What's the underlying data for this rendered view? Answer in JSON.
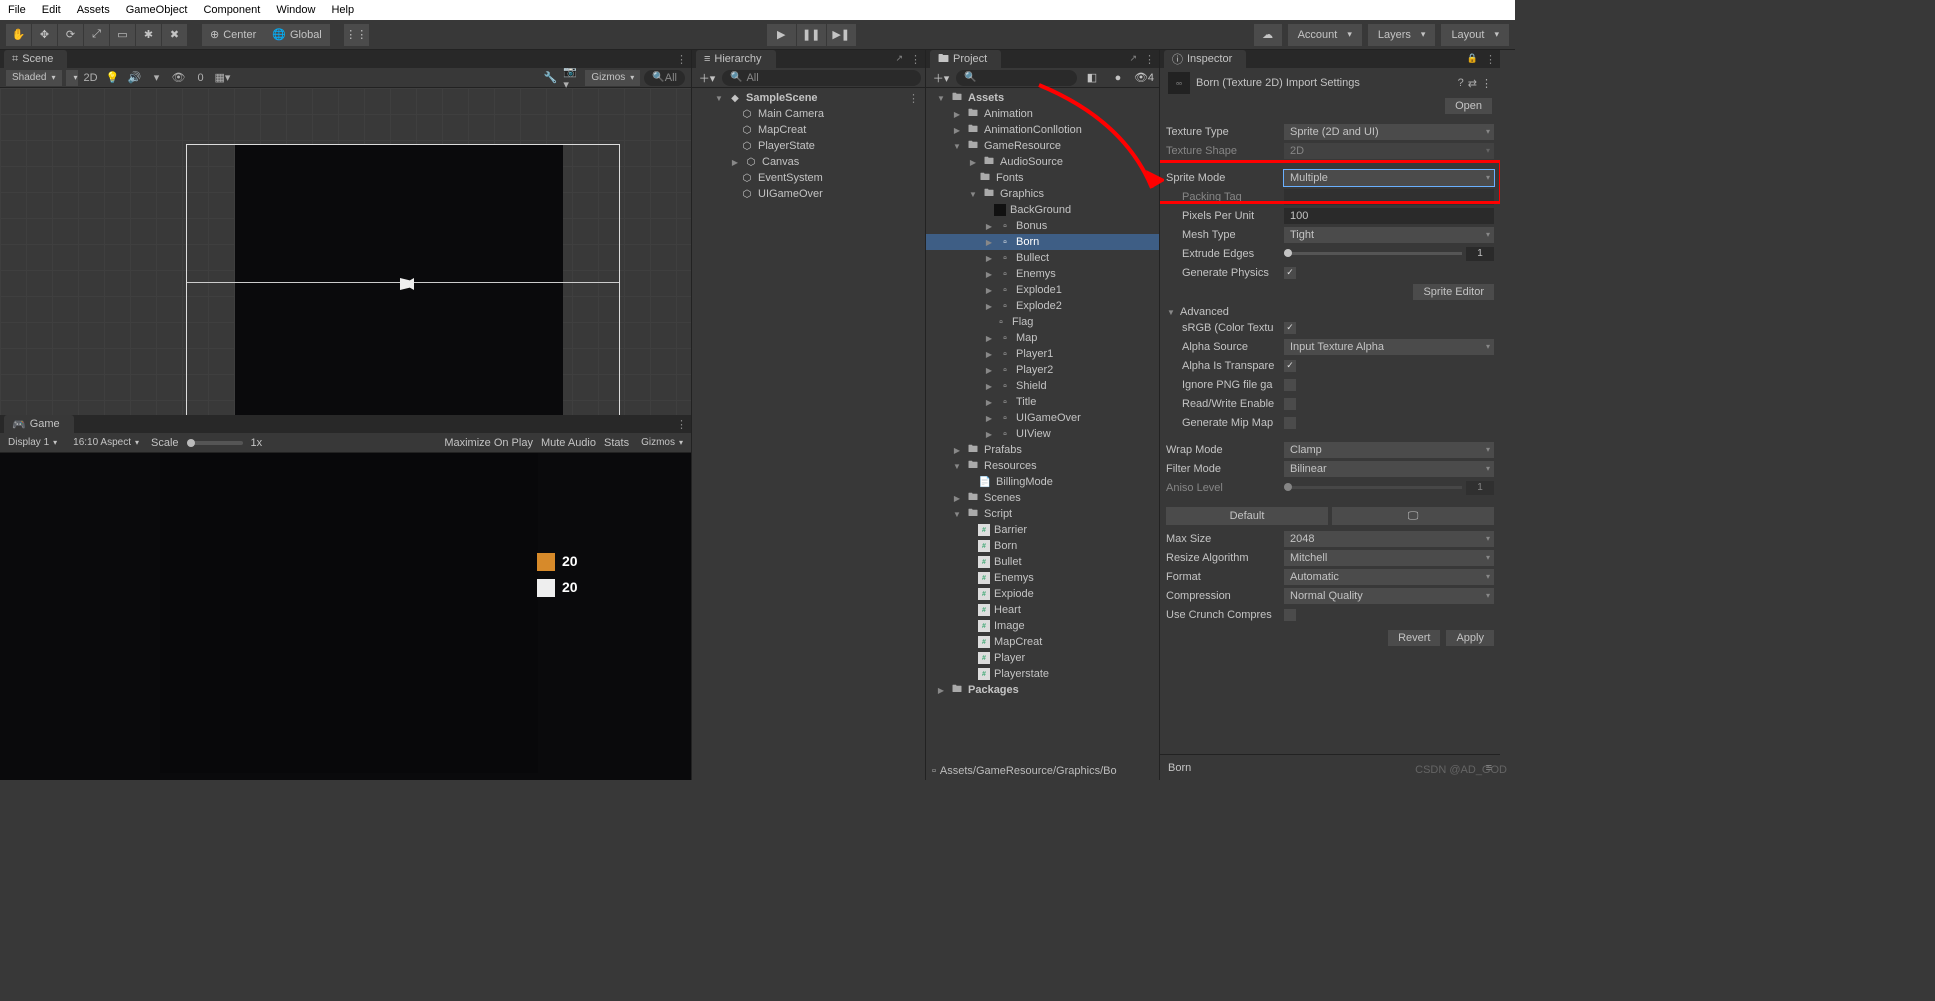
{
  "menu": [
    "File",
    "Edit",
    "Assets",
    "GameObject",
    "Component",
    "Window",
    "Help"
  ],
  "toolbar": {
    "pivot": "Center",
    "space": "Global",
    "account": "Account",
    "layers": "Layers",
    "layout": "Layout"
  },
  "scene": {
    "tab": "Scene",
    "shaded": "Shaded",
    "mode2d": "2D",
    "gizmos": "Gizmos",
    "allSearch": "All",
    "skyn": "0"
  },
  "game": {
    "tab": "Game",
    "display": "Display 1",
    "aspect": "16:10 Aspect",
    "scaleLbl": "Scale",
    "scaleVal": "1x",
    "maxOnPlay": "Maximize On Play",
    "muteAudio": "Mute Audio",
    "stats": "Stats",
    "gizmos": "Gizmos",
    "score1": "20",
    "score2": "20"
  },
  "hierarchy": {
    "tab": "Hierarchy",
    "searchPh": "All",
    "root": "SampleScene",
    "items": [
      "Main Camera",
      "MapCreat",
      "PlayerState",
      "Canvas",
      "EventSystem",
      "UIGameOver"
    ]
  },
  "project": {
    "tab": "Project",
    "searchPh": "",
    "lockCount": "4",
    "tree": {
      "assets": "Assets",
      "animation": "Animation",
      "animConf": "AnimationConllotion",
      "gameRes": "GameResource",
      "audio": "AudioSource",
      "fonts": "Fonts",
      "graphics": "Graphics",
      "graphicsItems": [
        "BackGround",
        "Bonus",
        "Born",
        "Bullect",
        "Enemys",
        "Explode1",
        "Explode2",
        "Flag",
        "Map",
        "Player1",
        "Player2",
        "Shield",
        "Title",
        "UIGameOver",
        "UIView"
      ],
      "prafabs": "Prafabs",
      "resources": "Resources",
      "billing": "BillingMode",
      "scenes": "Scenes",
      "script": "Script",
      "scripts": [
        "Barrier",
        "Born",
        "Bullet",
        "Enemys",
        "Expiode",
        "Heart",
        "Image",
        "MapCreat",
        "Player",
        "Playerstate"
      ],
      "packages": "Packages"
    },
    "path": "Assets/GameResource/Graphics/Bo"
  },
  "inspector": {
    "tab": "Inspector",
    "title": "Born (Texture 2D) Import Settings",
    "open": "Open",
    "textureType_lbl": "Texture Type",
    "textureType": "Sprite (2D and UI)",
    "textureShape_lbl": "Texture Shape",
    "textureShape": "2D",
    "spriteMode_lbl": "Sprite Mode",
    "spriteMode": "Multiple",
    "packingTag_lbl": "Packing Tag",
    "ppu_lbl": "Pixels Per Unit",
    "ppu": "100",
    "meshType_lbl": "Mesh Type",
    "meshType": "Tight",
    "extrude_lbl": "Extrude Edges",
    "extrude": "1",
    "genPhys_lbl": "Generate Physics",
    "spriteEditor": "Sprite Editor",
    "advanced": "Advanced",
    "srgb_lbl": "sRGB (Color Textu",
    "alphaSrc_lbl": "Alpha Source",
    "alphaSrc": "Input Texture Alpha",
    "alphaTrans_lbl": "Alpha Is Transpare",
    "ignorePng_lbl": "Ignore PNG file ga",
    "rw_lbl": "Read/Write Enable",
    "mip_lbl": "Generate Mip Map",
    "wrap_lbl": "Wrap Mode",
    "wrap": "Clamp",
    "filter_lbl": "Filter Mode",
    "filter": "Bilinear",
    "aniso_lbl": "Aniso Level",
    "aniso": "1",
    "default": "Default",
    "maxSize_lbl": "Max Size",
    "maxSize": "2048",
    "resize_lbl": "Resize Algorithm",
    "resize": "Mitchell",
    "format_lbl": "Format",
    "format": "Automatic",
    "compression_lbl": "Compression",
    "compression": "Normal Quality",
    "crunch_lbl": "Use Crunch Compres",
    "revert": "Revert",
    "apply": "Apply",
    "footerName": "Born"
  },
  "watermark": "CSDN @AD_GOD"
}
